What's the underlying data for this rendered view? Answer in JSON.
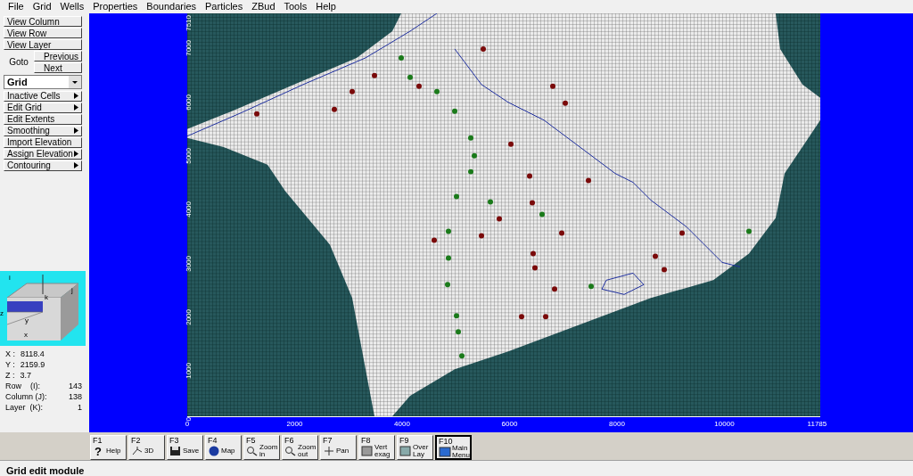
{
  "menu": [
    "File",
    "Grid",
    "Wells",
    "Properties",
    "Boundaries",
    "Particles",
    "ZBud",
    "Tools",
    "Help"
  ],
  "view_buttons": [
    "View Column",
    "View Row",
    "View Layer"
  ],
  "goto": {
    "label": "Goto",
    "previous": "Previous",
    "next": "Next"
  },
  "mode_dropdown": {
    "value": "Grid"
  },
  "tool_buttons": [
    {
      "label": "Inactive Cells",
      "submenu": true
    },
    {
      "label": "Edit Grid",
      "submenu": true
    },
    {
      "label": "Edit Extents",
      "submenu": false
    },
    {
      "label": "Smoothing",
      "submenu": true
    },
    {
      "label": "Import Elevation",
      "submenu": false
    },
    {
      "label": "Assign Elevation",
      "submenu": true
    },
    {
      "label": "Contouring",
      "submenu": true
    }
  ],
  "cube_labels": {
    "i": "i",
    "j": "j",
    "k": "k",
    "x": "x",
    "y": "y",
    "z": "z"
  },
  "coordinates": [
    {
      "label": "X :",
      "value": "8118.4"
    },
    {
      "label": "Y :",
      "value": "2159.9"
    },
    {
      "label": "Z :",
      "value": "3.7"
    }
  ],
  "indices": [
    {
      "label": "Row    (I):",
      "value": "143"
    },
    {
      "label": "Column (J):",
      "value": "138"
    },
    {
      "label": "Layer  (K):",
      "value": "1"
    }
  ],
  "y_axis_ticks": [
    "0",
    "1000",
    "2000",
    "3000",
    "4000",
    "5000",
    "6000",
    "7000",
    "7510"
  ],
  "x_axis_ticks": [
    "0",
    "2000",
    "4000",
    "6000",
    "8000",
    "10000",
    "11785"
  ],
  "function_keys": [
    {
      "key": "F1",
      "label": "Help",
      "icon_char": "?",
      "selected": false
    },
    {
      "key": "F2",
      "label": "3D",
      "selected": false
    },
    {
      "key": "F3",
      "label": "Save",
      "selected": false
    },
    {
      "key": "F4",
      "label": "Map",
      "selected": false
    },
    {
      "key": "F5",
      "label": "Zoom in",
      "selected": false
    },
    {
      "key": "F6",
      "label": "Zoom out",
      "selected": false
    },
    {
      "key": "F7",
      "label": "Pan",
      "selected": false
    },
    {
      "key": "F8",
      "label": "Vert exag",
      "selected": false
    },
    {
      "key": "F9",
      "label": "Over Lay",
      "selected": false
    },
    {
      "key": "F10",
      "label": "Main Menu",
      "selected": true
    }
  ],
  "status_bar": "Grid edit module"
}
